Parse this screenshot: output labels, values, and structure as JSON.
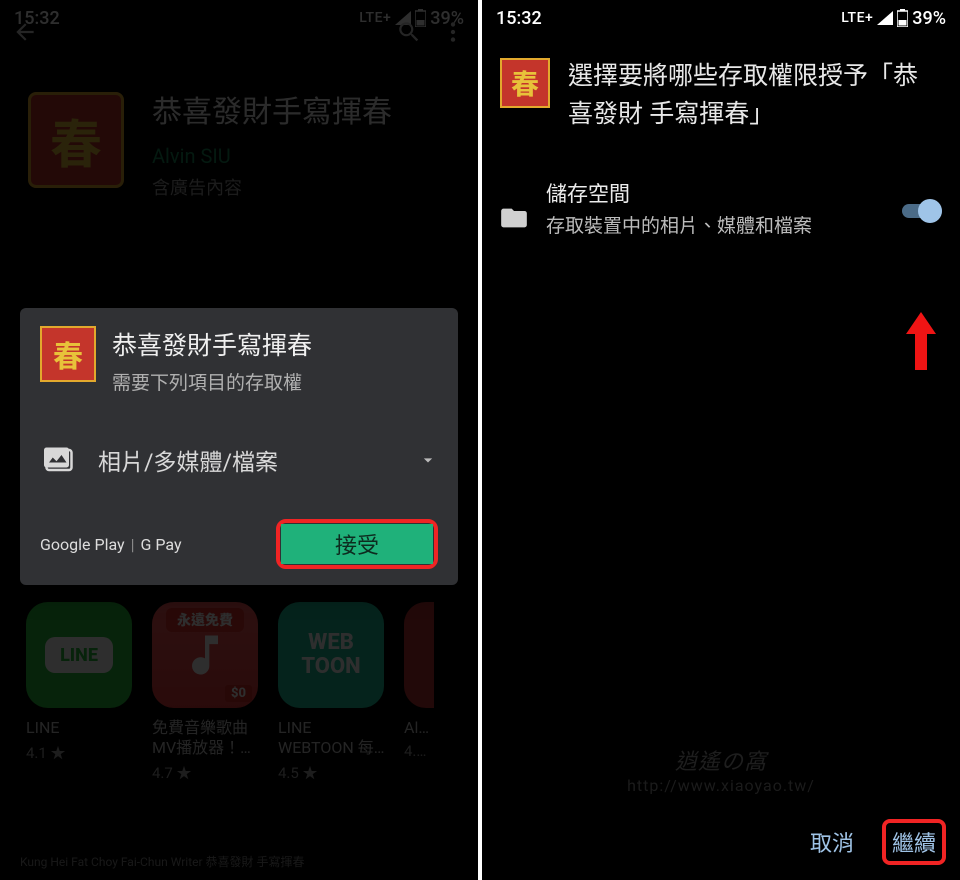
{
  "status_left": {
    "time": "15:32",
    "net": "LTE+",
    "battery": "39%"
  },
  "status_right": {
    "time": "15:32",
    "net": "LTE+",
    "battery": "39%"
  },
  "store": {
    "app_icon_char": "春",
    "title": "恭喜發財手寫揮春",
    "developer": "Alvin SIU",
    "ads_label": "含廣告內容"
  },
  "perm_dialog": {
    "icon_char": "春",
    "title": "恭喜發財手寫揮春",
    "subtitle": "需要下列項目的存取權",
    "item_label": "相片/多媒體/檔案",
    "footer_gplay": "Google Play",
    "footer_gpay": "G Pay",
    "accept": "接受"
  },
  "recs": [
    {
      "thumb_text": "LINE",
      "name": "LINE",
      "rating": "4.1 ★"
    },
    {
      "badge_free": "永遠免費",
      "price": "$0",
      "name": "免費音樂歌曲MV播放器！…",
      "rating": "4.7 ★"
    },
    {
      "thumb_text": "WEB\nTOON",
      "name": "LINE WEBTOON 每…",
      "rating": "4.5 ★"
    },
    {
      "name": "Al…",
      "rating": "4.…"
    }
  ],
  "ad_banner": "Kung Hei Fat Choy Fai-Chun Writer 恭喜發財 手寫揮春",
  "perm_screen": {
    "icon_char": "春",
    "title": "選擇要將哪些存取權限授予「恭喜發財 手寫揮春」",
    "group_title": "儲存空間",
    "group_desc": "存取裝置中的相片、媒體和檔案",
    "cancel": "取消",
    "continue": "繼續"
  },
  "watermark": {
    "name": "逍遙の窩",
    "url": "http://www.xiaoyao.tw/"
  }
}
